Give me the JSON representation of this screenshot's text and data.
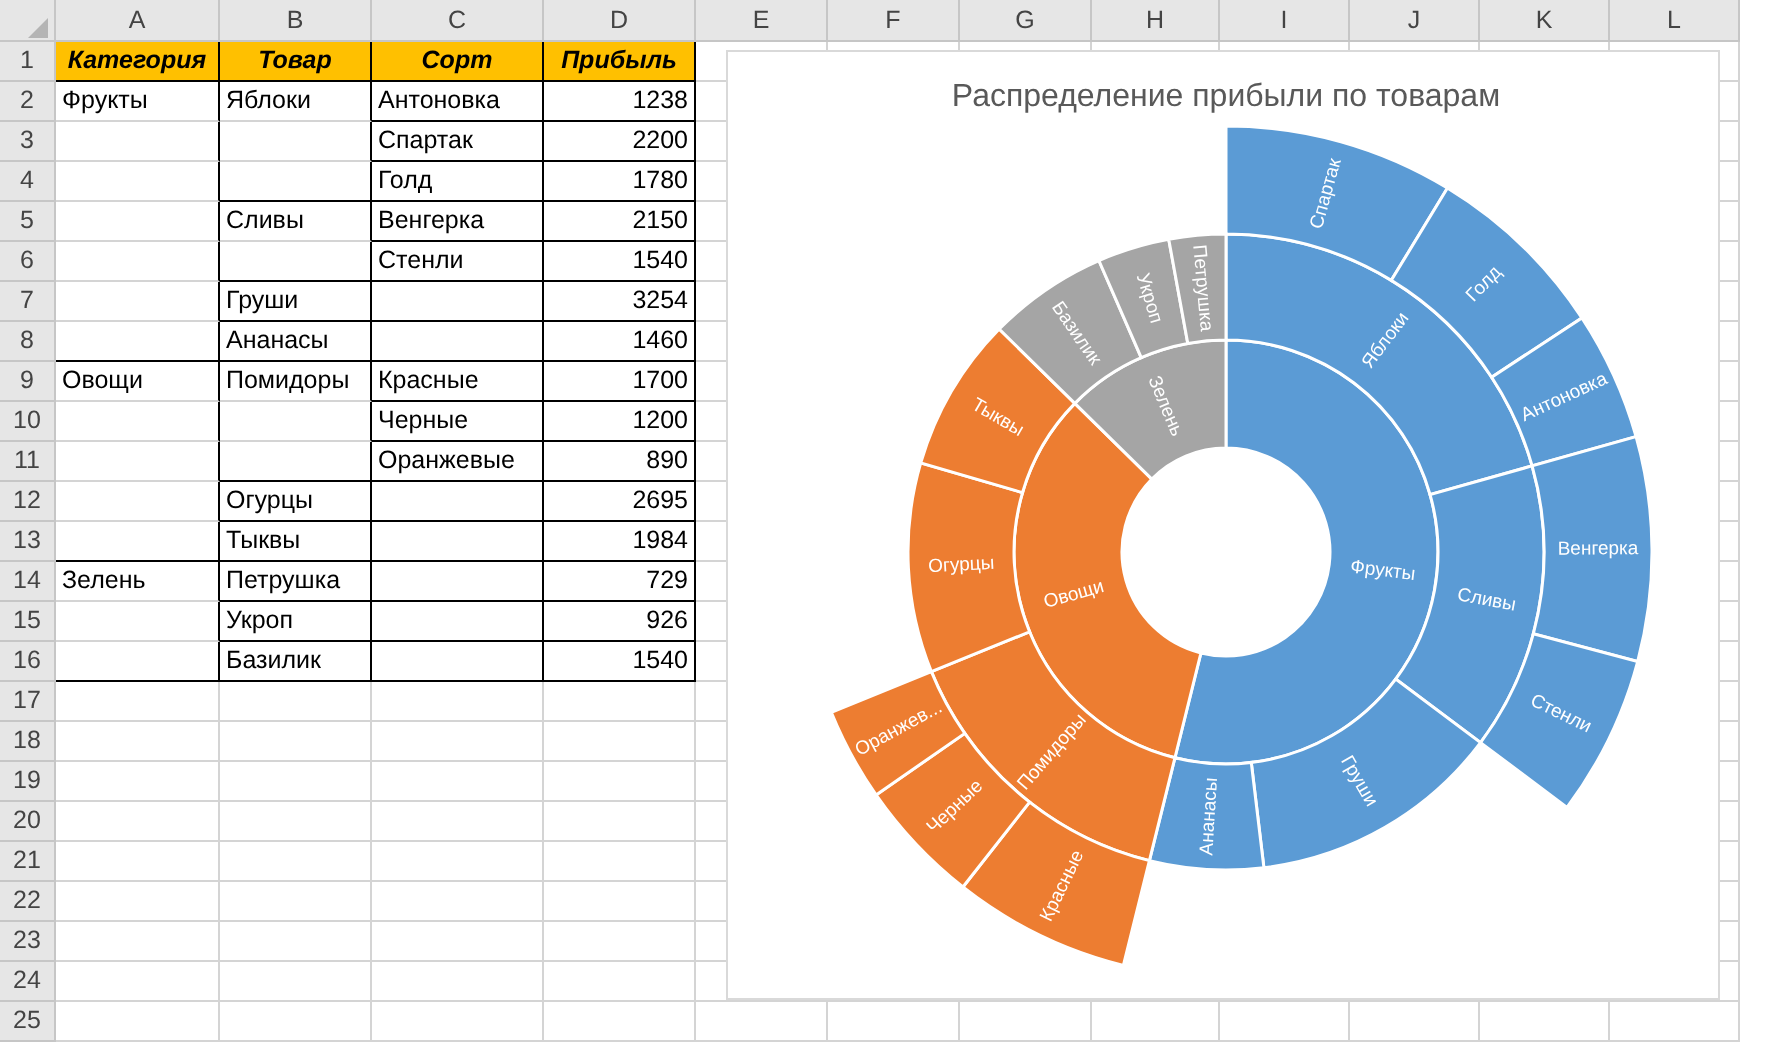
{
  "sheet": {
    "column_letters": [
      "A",
      "B",
      "C",
      "D",
      "E",
      "F",
      "G",
      "H",
      "I",
      "J",
      "K",
      "L"
    ],
    "row_numbers": [
      "1",
      "2",
      "3",
      "4",
      "5",
      "6",
      "7",
      "8",
      "9",
      "10",
      "11",
      "12",
      "13",
      "14",
      "15",
      "16",
      "17",
      "18",
      "19",
      "20",
      "21",
      "22",
      "23",
      "24",
      "25"
    ],
    "header": [
      "Категория",
      "Товар",
      "Сорт",
      "Прибыль"
    ],
    "rows": [
      {
        "category": "Фрукты",
        "product": "Яблоки",
        "variety": "Антоновка",
        "profit": "1238"
      },
      {
        "variety": "Спартак",
        "profit": "2200"
      },
      {
        "variety": "Голд",
        "profit": "1780"
      },
      {
        "product": "Сливы",
        "variety": "Венгерка",
        "profit": "2150"
      },
      {
        "variety": "Стенли",
        "profit": "1540"
      },
      {
        "product": "Груши",
        "profit": "3254"
      },
      {
        "product": "Ананасы",
        "profit": "1460"
      },
      {
        "category": "Овощи",
        "product": "Помидоры",
        "variety": "Красные",
        "profit": "1700"
      },
      {
        "variety": "Черные",
        "profit": "1200"
      },
      {
        "variety": "Оранжевые",
        "profit": "890"
      },
      {
        "product": "Огурцы",
        "profit": "2695"
      },
      {
        "product": "Тыквы",
        "profit": "1984"
      },
      {
        "category": "Зелень",
        "product": "Петрушка",
        "profit": "729"
      },
      {
        "product": "Укроп",
        "profit": "926"
      },
      {
        "product": "Базилик",
        "profit": "1540"
      }
    ]
  },
  "chart": {
    "title": "Распределение прибыли по товарам",
    "segments": [
      {
        "label": "Фрукты",
        "color": "#5b9bd5",
        "children": [
          {
            "label": "Яблоки",
            "children": [
              {
                "label": "Спартак"
              },
              {
                "label": "Голд"
              },
              {
                "label": "Антоновка"
              }
            ]
          },
          {
            "label": "Сливы",
            "children": [
              {
                "label": "Венгерка"
              },
              {
                "label": "Стенли"
              }
            ]
          },
          {
            "label": "Груши"
          },
          {
            "label": "Ананасы"
          }
        ]
      },
      {
        "label": "Овощи",
        "color": "#ed7d31",
        "children": [
          {
            "label": "Помидоры",
            "children": [
              {
                "label": "Красные"
              },
              {
                "label": "Черные"
              },
              {
                "label": "Оранжев..."
              }
            ]
          },
          {
            "label": "Огурцы"
          },
          {
            "label": "Тыквы"
          }
        ]
      },
      {
        "label": "Зелень",
        "color": "#a5a5a5",
        "children": [
          {
            "label": "Базилик"
          },
          {
            "label": "Укроп"
          },
          {
            "label": "Петрушка"
          }
        ]
      }
    ]
  }
}
